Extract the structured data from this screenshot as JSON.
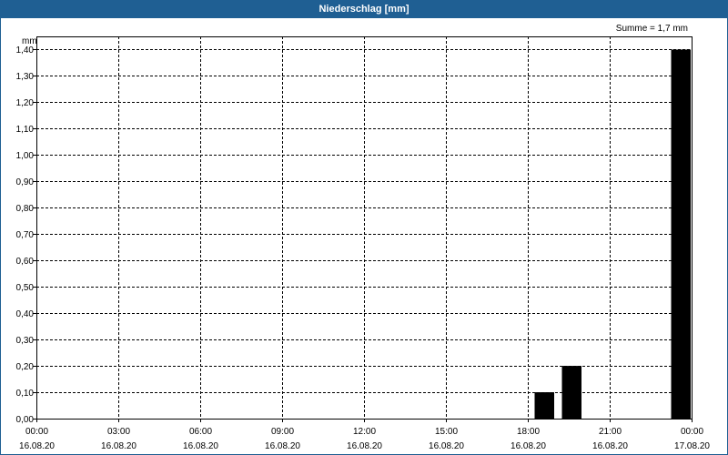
{
  "window": {
    "title": "Niederschlag [mm]"
  },
  "colors": {
    "titlebar": "#1f5f93",
    "bar": "#000000",
    "grid": "#000000"
  },
  "chart_data": {
    "type": "bar",
    "title": "Niederschlag [mm]",
    "ylabel": "mm",
    "annotation": "Summe = 1,7 mm",
    "ylim": [
      0,
      1.45
    ],
    "yticks": [
      "0,00",
      "0,10",
      "0,20",
      "0,30",
      "0,40",
      "0,50",
      "0,60",
      "0,70",
      "0,80",
      "0,90",
      "1,00",
      "1,10",
      "1,20",
      "1,30",
      "1,40"
    ],
    "ytick_values": [
      0,
      0.1,
      0.2,
      0.3,
      0.4,
      0.5,
      0.6,
      0.7,
      0.8,
      0.9,
      1.0,
      1.1,
      1.2,
      1.3,
      1.4
    ],
    "xlim_hours": [
      0,
      24
    ],
    "xticks": [
      {
        "hour": 0,
        "time": "00:00",
        "date": "16.08.20"
      },
      {
        "hour": 3,
        "time": "03:00",
        "date": "16.08.20"
      },
      {
        "hour": 6,
        "time": "06:00",
        "date": "16.08.20"
      },
      {
        "hour": 9,
        "time": "09:00",
        "date": "16.08.20"
      },
      {
        "hour": 12,
        "time": "12:00",
        "date": "16.08.20"
      },
      {
        "hour": 15,
        "time": "15:00",
        "date": "16.08.20"
      },
      {
        "hour": 18,
        "time": "18:00",
        "date": "16.08.20"
      },
      {
        "hour": 21,
        "time": "21:00",
        "date": "16.08.20"
      },
      {
        "hour": 24,
        "time": "00:00",
        "date": "17.08.20"
      }
    ],
    "bars": [
      {
        "start": "16.08.20 18:15",
        "end": "16.08.20 19:00",
        "value": 0.1
      },
      {
        "start": "16.08.20 19:15",
        "end": "16.08.20 20:00",
        "value": 0.2
      },
      {
        "start": "16.08.20 23:15",
        "end": "17.08.20 00:00",
        "value": 1.4
      }
    ],
    "grid": true
  }
}
